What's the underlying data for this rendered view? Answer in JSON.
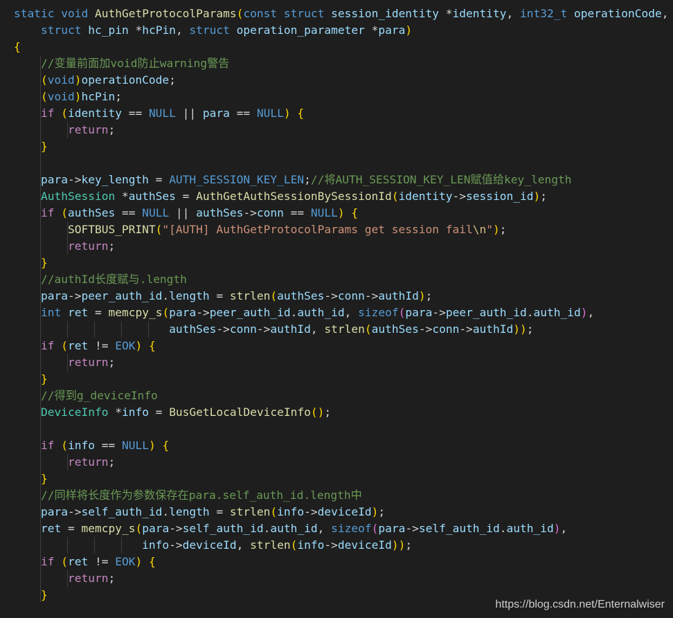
{
  "editor": {
    "lines": [
      "static void AuthGetProtocolParams(const struct session_identity *identity, int32_t operationCode,",
      "    struct hc_pin *hcPin, struct operation_parameter *para)",
      "{",
      "    //变量前面加void防止warning警告",
      "    (void)operationCode;",
      "    (void)hcPin;",
      "    if (identity == NULL || para == NULL) {",
      "        return;",
      "    }",
      "",
      "    para->key_length = AUTH_SESSION_KEY_LEN;//将AUTH_SESSION_KEY_LEN赋值给key_length",
      "    AuthSession *authSes = AuthGetAuthSessionBySessionId(identity->session_id);",
      "    if (authSes == NULL || authSes->conn == NULL) {",
      "        SOFTBUS_PRINT(\"[AUTH] AuthGetProtocolParams get session fail\\n\");",
      "        return;",
      "    }",
      "    //authId长度赋与.length",
      "    para->peer_auth_id.length = strlen(authSes->conn->authId);",
      "    int ret = memcpy_s(para->peer_auth_id.auth_id, sizeof(para->peer_auth_id.auth_id),",
      "                       authSes->conn->authId, strlen(authSes->conn->authId));",
      "    if (ret != EOK) {",
      "        return;",
      "    }",
      "    //得到g_deviceInfo",
      "    DeviceInfo *info = BusGetLocalDeviceInfo();",
      "",
      "    if (info == NULL) {",
      "        return;",
      "    }",
      "    //同样将长度作为参数保存在para.self_auth_id.length中",
      "    para->self_auth_id.length = strlen(info->deviceId);",
      "    ret = memcpy_s(para->self_auth_id.auth_id, sizeof(para->self_auth_id.auth_id),",
      "                   info->deviceId, strlen(info->deviceId));",
      "    if (ret != EOK) {",
      "        return;",
      "    }"
    ]
  },
  "watermark": "https://blog.csdn.net/Enternalwiser"
}
